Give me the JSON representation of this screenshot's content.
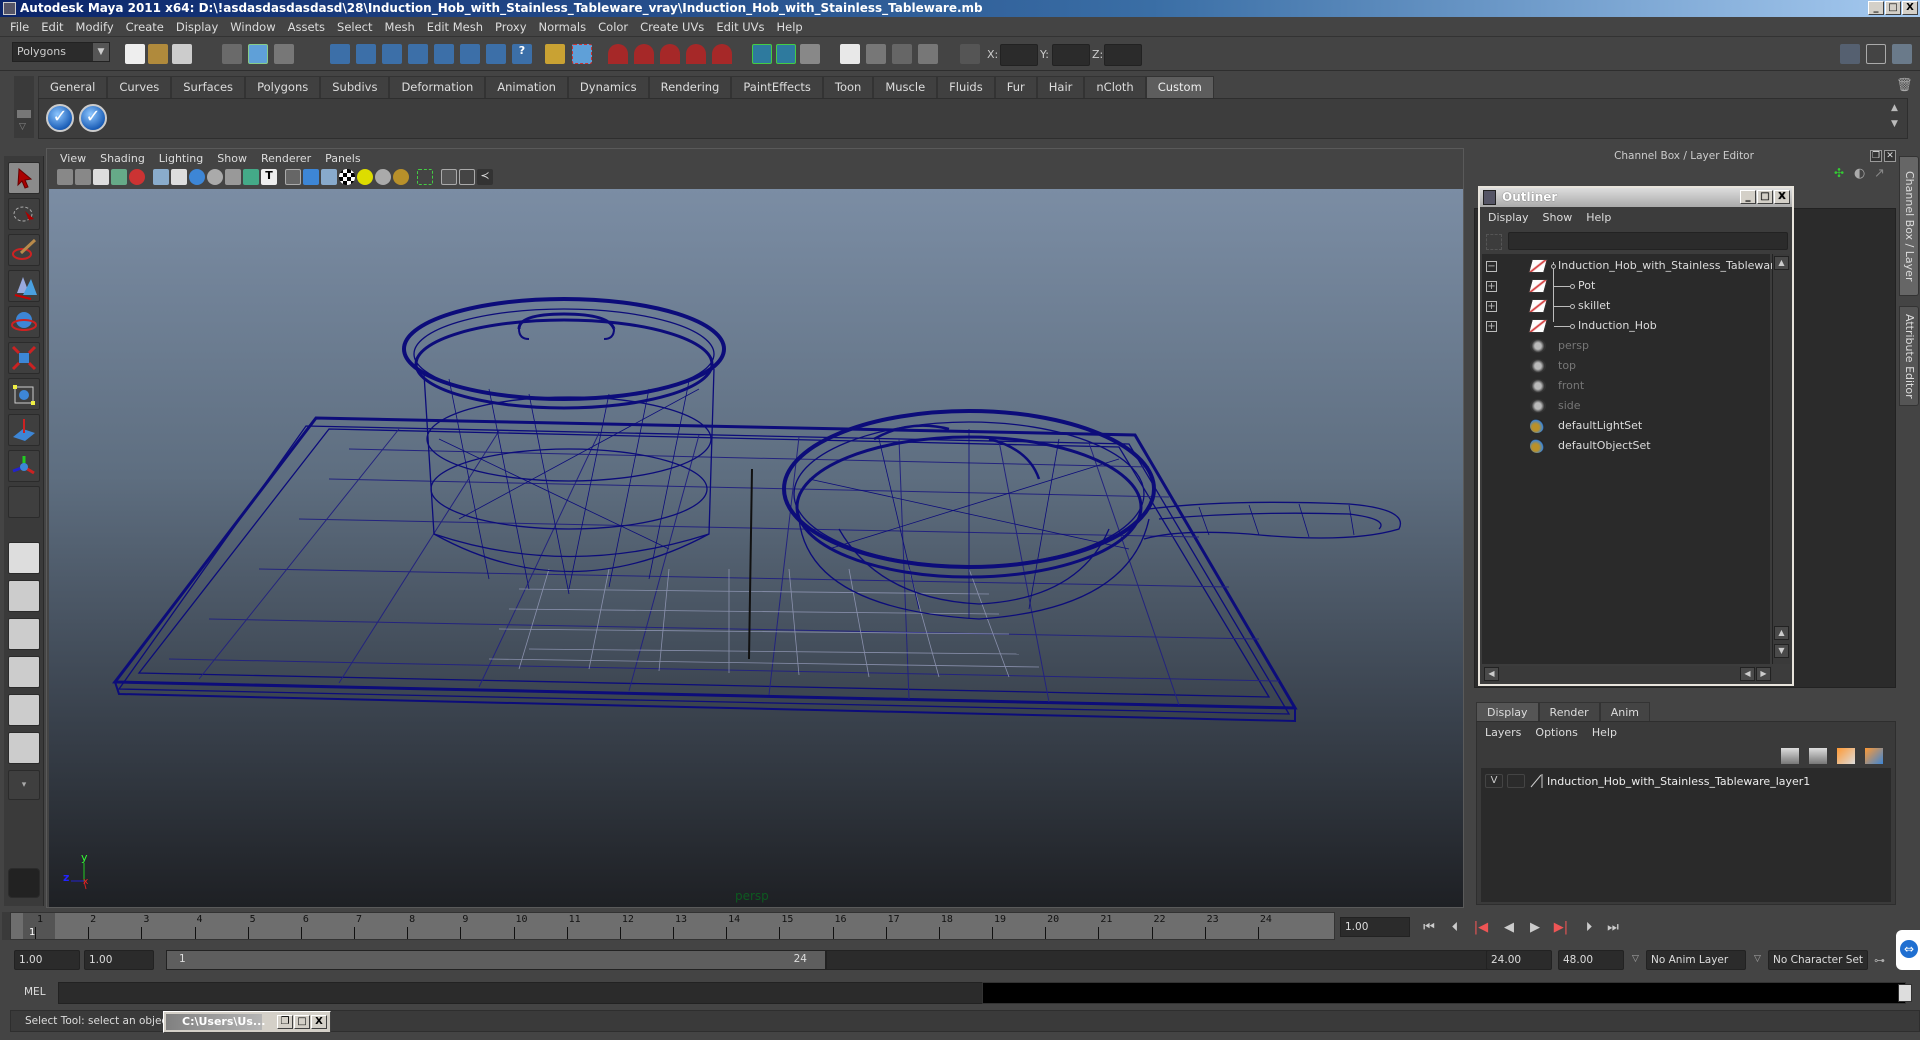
{
  "window": {
    "title": "Autodesk Maya 2011 x64: D:\\!asdasdasdasdasd\\28\\Induction_Hob_with_Stainless_Tableware_vray\\Induction_Hob_with_Stainless_Tableware.mb",
    "controls": [
      "_",
      "□",
      "X"
    ]
  },
  "menubar": [
    "File",
    "Edit",
    "Modify",
    "Create",
    "Display",
    "Window",
    "Assets",
    "Select",
    "Mesh",
    "Edit Mesh",
    "Proxy",
    "Normals",
    "Color",
    "Create UVs",
    "Edit UVs",
    "Help"
  ],
  "statusline": {
    "mode": "Polygons",
    "x_label": "X:",
    "y_label": "Y:",
    "z_label": "Z:",
    "x_value": "",
    "y_value": "",
    "z_value": ""
  },
  "shelf": {
    "tabs": [
      "General",
      "Curves",
      "Surfaces",
      "Polygons",
      "Subdivs",
      "Deformation",
      "Animation",
      "Dynamics",
      "Rendering",
      "PaintEffects",
      "Toon",
      "Muscle",
      "Fluids",
      "Fur",
      "Hair",
      "nCloth",
      "Custom"
    ],
    "active_tab": "Custom",
    "buttons": [
      "check-button-1",
      "check-button-2"
    ]
  },
  "toolbox": {
    "tools": [
      "select-tool",
      "lasso-tool",
      "paint-select-tool",
      "move-tool",
      "rotate-tool",
      "scale-tool",
      "universal-manipulator",
      "soft-modification-tool",
      "show-manipulator",
      "last-used-tool"
    ],
    "layouts": [
      "single-perspective",
      "four-view",
      "outliner-persp",
      "persp-graph",
      "hypershade-persp",
      "persp-outliner-graph"
    ]
  },
  "viewport": {
    "menu": [
      "View",
      "Shading",
      "Lighting",
      "Show",
      "Renderer",
      "Panels"
    ],
    "camera": "persp",
    "axis": {
      "y": "y",
      "z": "z",
      "x": "x"
    }
  },
  "channelbox": {
    "header": "Channel Box / Layer Editor",
    "side_tabs": [
      "Channel Box / Layer Editor",
      "Attribute Editor"
    ]
  },
  "outliner": {
    "title": "Outliner",
    "menu": [
      "Display",
      "Show",
      "Help"
    ],
    "filter": "",
    "items": [
      {
        "label": "Induction_Hob_with_Stainless_Tableware",
        "type": "transform",
        "expand": "−",
        "dim": false
      },
      {
        "label": "Pot",
        "type": "transform",
        "expand": "+",
        "dim": false,
        "child": true
      },
      {
        "label": "skillet",
        "type": "transform",
        "expand": "+",
        "dim": false,
        "child": true
      },
      {
        "label": "Induction_Hob",
        "type": "transform",
        "expand": "+",
        "dim": false,
        "child": true
      },
      {
        "label": "persp",
        "type": "camera",
        "dim": true
      },
      {
        "label": "top",
        "type": "camera",
        "dim": true
      },
      {
        "label": "front",
        "type": "camera",
        "dim": true
      },
      {
        "label": "side",
        "type": "camera",
        "dim": true
      },
      {
        "label": "defaultLightSet",
        "type": "set",
        "dim": false
      },
      {
        "label": "defaultObjectSet",
        "type": "set",
        "dim": false
      }
    ]
  },
  "layer_editor": {
    "tabs": [
      "Display",
      "Render",
      "Anim"
    ],
    "active_tab": "Display",
    "menu": [
      "Layers",
      "Options",
      "Help"
    ],
    "layers": [
      {
        "visible": "V",
        "playback": "",
        "name": "Induction_Hob_with_Stainless_Tableware_layer1"
      }
    ]
  },
  "timeline": {
    "ticks": [
      "1",
      "2",
      "3",
      "4",
      "5",
      "6",
      "7",
      "8",
      "9",
      "10",
      "11",
      "12",
      "13",
      "14",
      "15",
      "16",
      "17",
      "18",
      "19",
      "20",
      "21",
      "22",
      "23",
      "24"
    ],
    "current_frame": "1",
    "current_time_field": "1.00"
  },
  "range": {
    "start_time": "1.00",
    "playback_start": "1.00",
    "slider_start": "1",
    "slider_end": "24",
    "playback_end": "24.00",
    "end_time": "48.00",
    "anim_layer": "No Anim Layer",
    "character_set": "No Character Set"
  },
  "commandline": {
    "label": "MEL",
    "input": "",
    "output": ""
  },
  "helpline": {
    "text": "Select Tool: select an object",
    "minimized_window": "C:\\Users\\Us..."
  }
}
